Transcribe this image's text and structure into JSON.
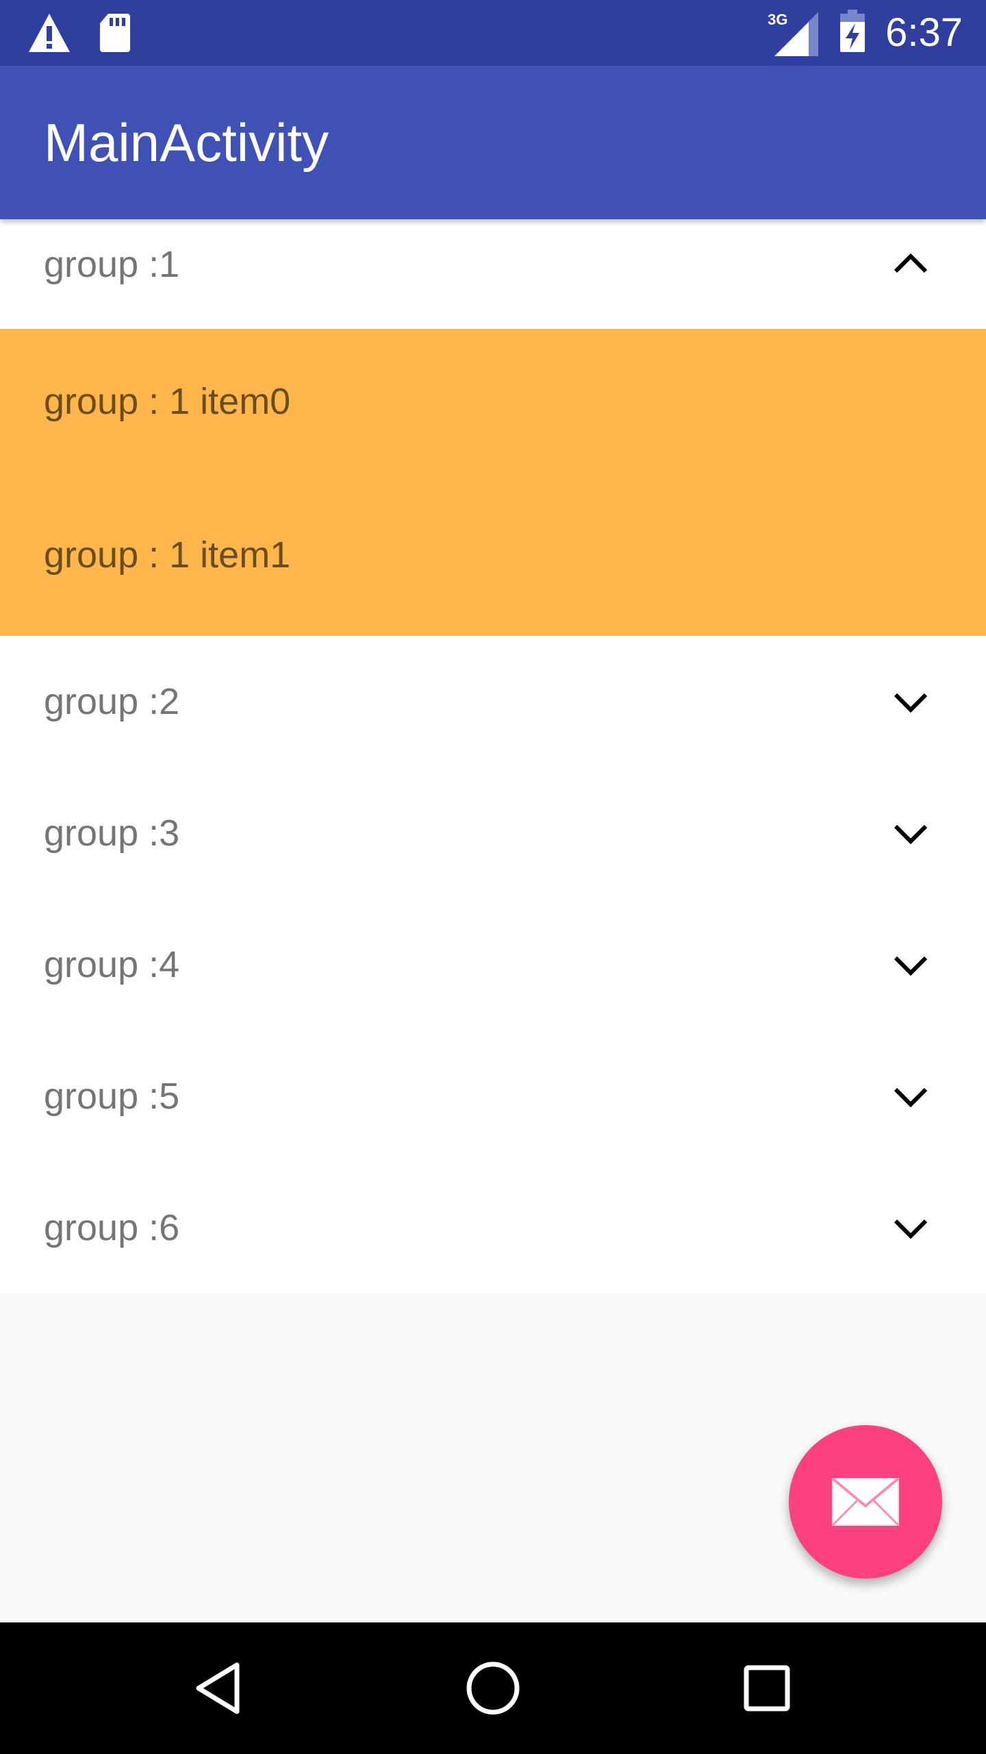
{
  "status_bar": {
    "time": "6:37",
    "network_type": "3G",
    "icons": [
      "warning-icon",
      "sd-card-icon",
      "signal-icon",
      "battery-charging-icon"
    ]
  },
  "app_bar": {
    "title": "MainActivity"
  },
  "groups": [
    {
      "label": "group :1",
      "expanded": true,
      "children": [
        "group : 1 item0",
        "group : 1 item1"
      ]
    },
    {
      "label": "group :2",
      "expanded": false
    },
    {
      "label": "group :3",
      "expanded": false
    },
    {
      "label": "group :4",
      "expanded": false
    },
    {
      "label": "group :5",
      "expanded": false
    },
    {
      "label": "group :6",
      "expanded": false
    }
  ],
  "fab": {
    "icon": "mail-icon"
  },
  "nav_bar": {
    "icons": [
      "back-icon",
      "home-icon",
      "recents-icon"
    ]
  },
  "colors": {
    "status_bar": "#303F9F",
    "app_bar": "#3F51B5",
    "child_background": "#FFB74D",
    "fab": "#FF4081"
  }
}
